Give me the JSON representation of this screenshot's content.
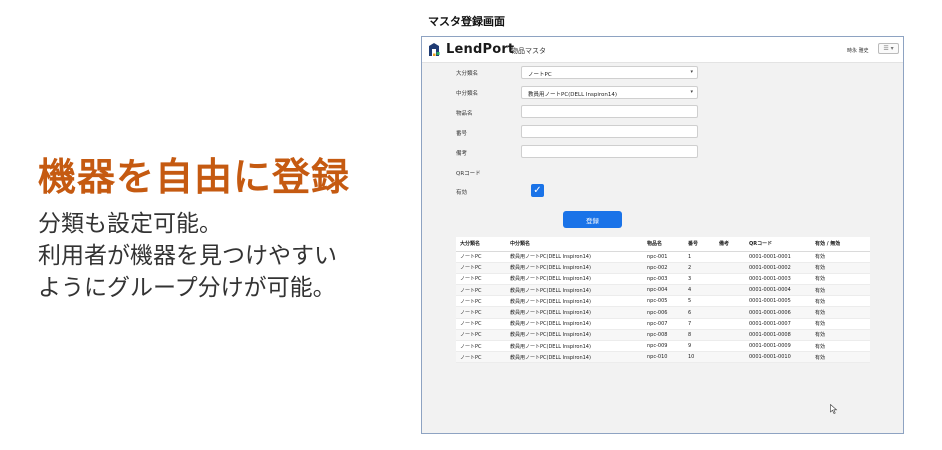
{
  "promo": {
    "headline": "機器を自由に登録",
    "lines": [
      "分類も設定可能。",
      "利用者が機器を見つけやすい",
      "ようにグループ分けが可能。"
    ]
  },
  "caption": "マスタ登録画面",
  "app": {
    "brand": "LendPort",
    "page_title": "物品マスタ",
    "user_name": "時永 雅史",
    "menu_icon": "hamburger-icon"
  },
  "form": {
    "major_category": {
      "label": "大分類名",
      "value": "ノートPC"
    },
    "minor_category": {
      "label": "中分類名",
      "value": "教員用ノートPC(DELL Inspiron14)"
    },
    "item_name": {
      "label": "物品名",
      "value": ""
    },
    "number": {
      "label": "番号",
      "value": ""
    },
    "remarks": {
      "label": "備考",
      "value": ""
    },
    "qr_code": {
      "label": "QRコード"
    },
    "active": {
      "label": "有効",
      "checked": true
    },
    "submit_label": "登録"
  },
  "table": {
    "headers": [
      "大分類名",
      "中分類名",
      "物品名",
      "番号",
      "備考",
      "QRコード",
      "有効 / 無効"
    ],
    "rows": [
      [
        "ノートPC",
        "教員用ノートPC(DELL Inspiron14)",
        "npc-001",
        "1",
        "",
        "0001-0001-0001",
        "有効"
      ],
      [
        "ノートPC",
        "教員用ノートPC(DELL Inspiron14)",
        "npc-002",
        "2",
        "",
        "0001-0001-0002",
        "有効"
      ],
      [
        "ノートPC",
        "教員用ノートPC(DELL Inspiron14)",
        "npc-003",
        "3",
        "",
        "0001-0001-0003",
        "有効"
      ],
      [
        "ノートPC",
        "教員用ノートPC(DELL Inspiron14)",
        "npc-004",
        "4",
        "",
        "0001-0001-0004",
        "有効"
      ],
      [
        "ノートPC",
        "教員用ノートPC(DELL Inspiron14)",
        "npc-005",
        "5",
        "",
        "0001-0001-0005",
        "有効"
      ],
      [
        "ノートPC",
        "教員用ノートPC(DELL Inspiron14)",
        "npc-006",
        "6",
        "",
        "0001-0001-0006",
        "有効"
      ],
      [
        "ノートPC",
        "教員用ノートPC(DELL Inspiron14)",
        "npc-007",
        "7",
        "",
        "0001-0001-0007",
        "有効"
      ],
      [
        "ノートPC",
        "教員用ノートPC(DELL Inspiron14)",
        "npc-008",
        "8",
        "",
        "0001-0001-0008",
        "有効"
      ],
      [
        "ノートPC",
        "教員用ノートPC(DELL Inspiron14)",
        "npc-009",
        "9",
        "",
        "0001-0001-0009",
        "有効"
      ],
      [
        "ノートPC",
        "教員用ノートPC(DELL Inspiron14)",
        "npc-010",
        "10",
        "",
        "0001-0001-0010",
        "有効"
      ]
    ]
  },
  "colors": {
    "accent": "#c55a11",
    "primary": "#1a73e8"
  }
}
